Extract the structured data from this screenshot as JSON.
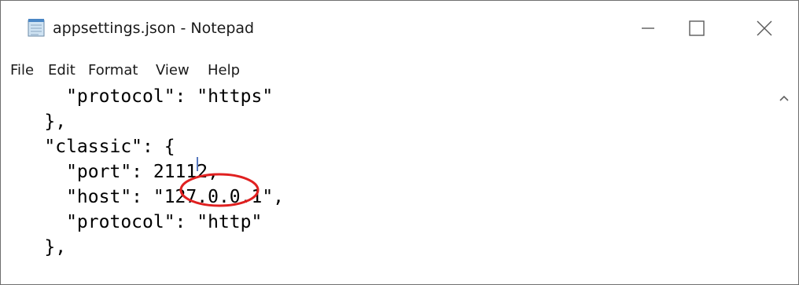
{
  "window": {
    "title": "appsettings.json - Notepad",
    "controls": {
      "minimize_icon": "minimize-icon",
      "maximize_icon": "maximize-icon",
      "close_icon": "close-icon"
    }
  },
  "menu": {
    "items": [
      {
        "label": "File"
      },
      {
        "label": "Edit"
      },
      {
        "label": "Format"
      },
      {
        "label": "View"
      },
      {
        "label": "Help"
      }
    ]
  },
  "editor": {
    "lines": [
      "      \"protocol\": \"https\"",
      "    },",
      "    \"classic\": {",
      "      \"port\": 21112,",
      "      \"host\": \"127.0.0.1\",",
      "      \"protocol\": \"http\"",
      "    },"
    ]
  },
  "annotation": {
    "highlighted_value": "21112",
    "color": "#e02020"
  },
  "colors": {
    "background": "#ffffff",
    "text": "#000000",
    "annotation": "#e02020"
  }
}
